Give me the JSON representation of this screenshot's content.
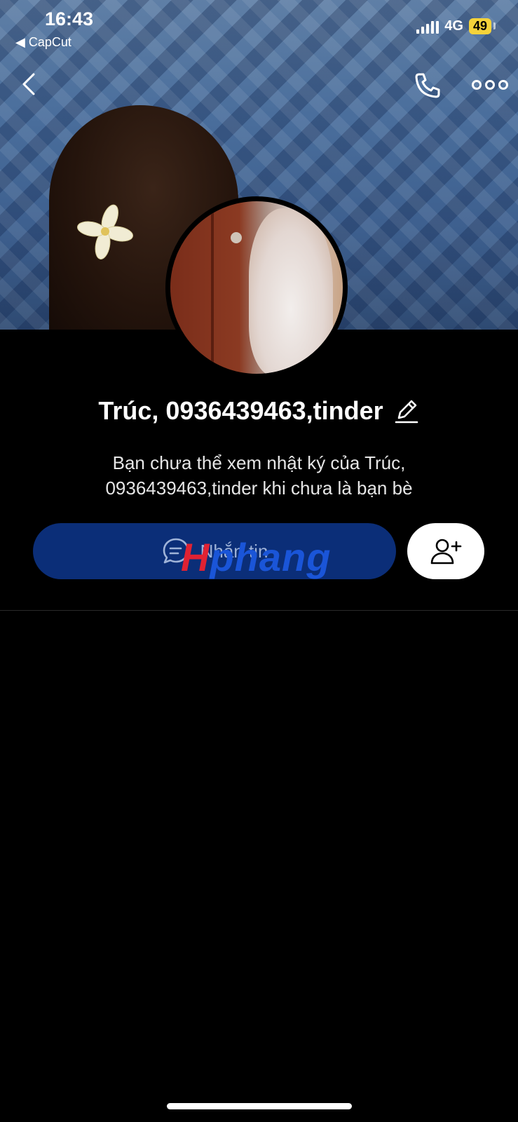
{
  "status_bar": {
    "time": "16:43",
    "back_app": "◀ CapCut",
    "network": "4G",
    "battery": "49"
  },
  "header": {
    "back_icon": "chevron-left-icon",
    "call_icon": "phone-icon",
    "more_icon": "more-dots-icon"
  },
  "profile": {
    "name": "Trúc, 0936439463,tinder",
    "privacy_note": "Bạn chưa thể xem nhật ký của Trúc, 0936439463,tinder khi chưa là bạn bè"
  },
  "actions": {
    "message_label": "Nhắn tin",
    "message_icon": "chat-icon",
    "add_friend_icon": "add-friend-icon"
  },
  "watermark": {
    "part1": "H",
    "part2": "phang"
  },
  "colors": {
    "background": "#000000",
    "message_button": "#0b2e78",
    "battery": "#f5d33a"
  }
}
